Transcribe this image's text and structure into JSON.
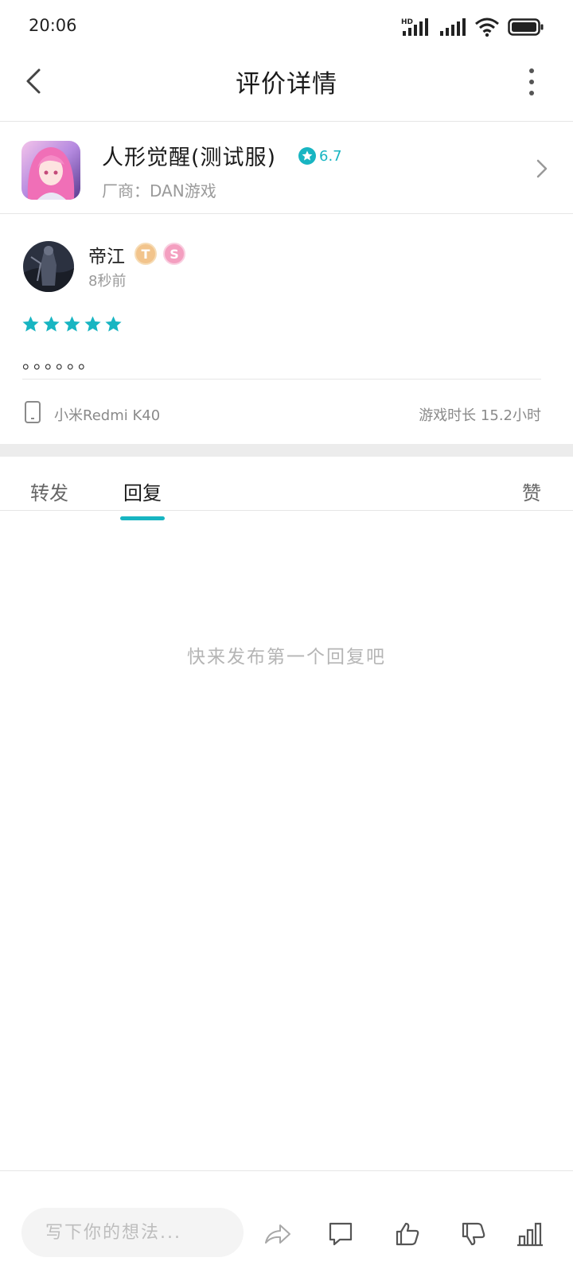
{
  "status_bar": {
    "time": "20:06",
    "hd_label": "HD"
  },
  "header": {
    "title": "评价详情"
  },
  "game": {
    "name": "人形觉醒(测试服)",
    "score": "6.7",
    "vendor": "厂商：DAN游戏",
    "accent_color": "#18b5c2"
  },
  "review": {
    "user_name": "帝江",
    "badges": [
      "T",
      "S"
    ],
    "time": "8秒前",
    "stars": 5,
    "text": "。。。。。。",
    "device": "小米Redmi K40",
    "play_time": "游戏时长 15.2小时"
  },
  "tabs": [
    {
      "label": "转发"
    },
    {
      "label": "回复",
      "active": true
    },
    {
      "label": "赞"
    }
  ],
  "empty_state": {
    "text": "快来发布第一个回复吧"
  },
  "bottom_bar": {
    "input_placeholder": "写下你的想法...",
    "actions": [
      "share-icon",
      "comment-icon",
      "thumb-up-icon",
      "thumb-down-icon",
      "stats-icon"
    ]
  }
}
